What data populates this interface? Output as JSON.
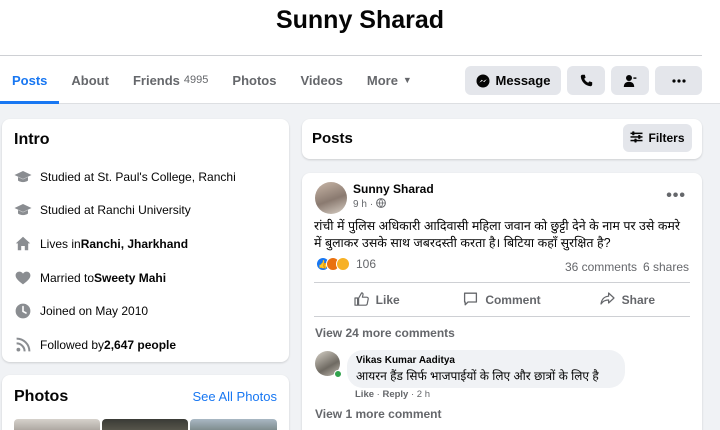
{
  "profile": {
    "name": "Sunny Sharad"
  },
  "tabs": [
    {
      "label": "Posts"
    },
    {
      "label": "About"
    },
    {
      "label": "Friends",
      "count": "4995"
    },
    {
      "label": "Photos"
    },
    {
      "label": "Videos"
    },
    {
      "label": "More"
    }
  ],
  "actions": {
    "message_label": "Message"
  },
  "intro": {
    "title": "Intro",
    "items": [
      {
        "icon": "graduation-cap-icon",
        "prefix": "Studied at St. Paul's College, Ranchi",
        "bold": "",
        "suffix": ""
      },
      {
        "icon": "graduation-cap-icon",
        "prefix": "Studied at Ranchi University",
        "bold": "",
        "suffix": ""
      },
      {
        "icon": "home-icon",
        "prefix": "Lives in ",
        "bold": "Ranchi, Jharkhand",
        "suffix": ""
      },
      {
        "icon": "heart-icon",
        "prefix": "Married to ",
        "bold": "Sweety Mahi",
        "suffix": ""
      },
      {
        "icon": "clock-icon",
        "prefix": "Joined on May 2010",
        "bold": "",
        "suffix": ""
      },
      {
        "icon": "rss-icon",
        "prefix": "Followed by ",
        "bold": "2,647 people",
        "suffix": ""
      }
    ]
  },
  "photos": {
    "title": "Photos",
    "see_all": "See All Photos"
  },
  "posts_header": {
    "title": "Posts",
    "filters_label": "Filters"
  },
  "post": {
    "author": "Sunny Sharad",
    "time": "9 h",
    "text": "रांची में पुलिस अधिकारी आदिवासी महिला जवान को छुट्टी देने के नाम पर उसे कमरे में बुलाकर उसके साथ जबरदस्ती करता है। बिटिया कहाँ सुरक्षित है?",
    "reaction_count": "106",
    "comments_count": "36 comments",
    "shares_count": "6 shares",
    "like_label": "Like",
    "comment_label": "Comment",
    "share_label": "Share",
    "view_more_comments": "View 24 more comments",
    "comment": {
      "author": "Vikas Kumar Aaditya",
      "text": "आयरन हैंड सिर्फ भाजपाईयों के लिए और छात्रों के लिए है",
      "like": "Like",
      "reply": "Reply",
      "time": "2 h"
    },
    "view_one_more": "View 1 more comment"
  },
  "colors": {
    "accent": "#1877f2",
    "background": "#f0f2f5",
    "secondary_text": "#65676b",
    "online": "#31a24c"
  }
}
